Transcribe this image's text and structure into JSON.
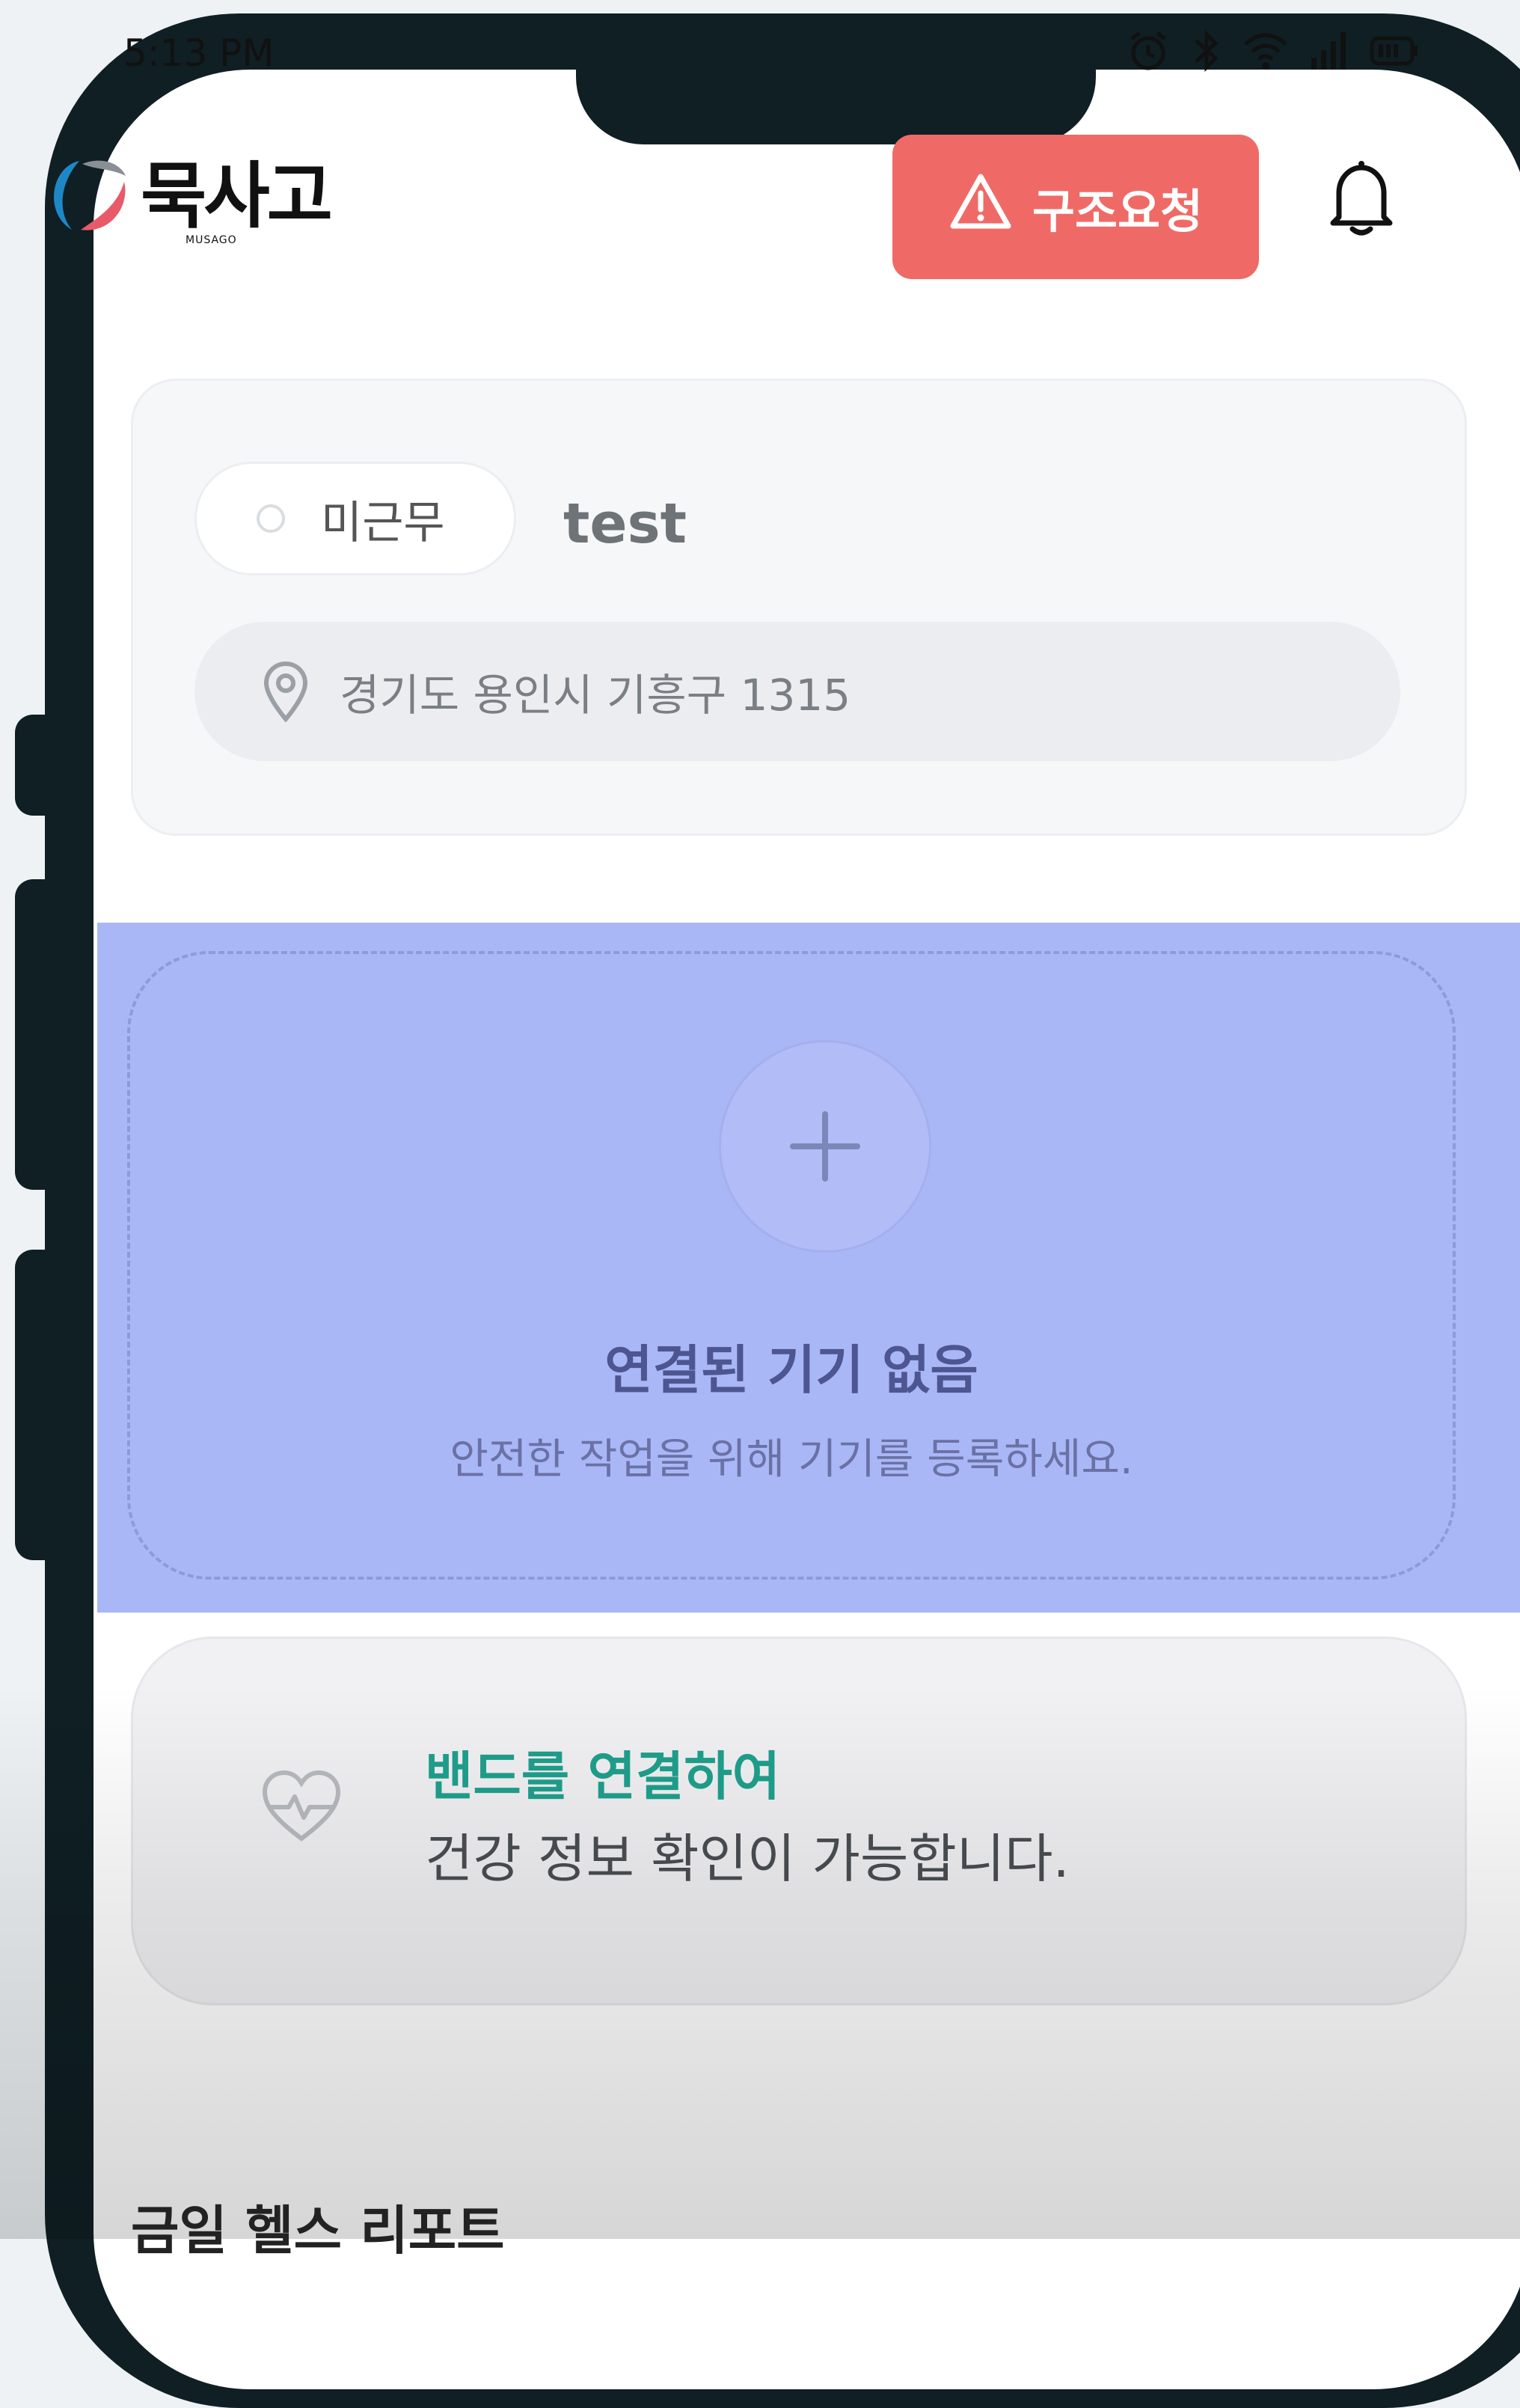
{
  "status_bar": {
    "time": "5:13 PM"
  },
  "header": {
    "logo_text": "묵사고",
    "logo_sub": "MUSAGO",
    "sos_label": "구조요청"
  },
  "worker": {
    "status": "미근무",
    "name": "test",
    "location": "경기도 용인시 기흥구 1315"
  },
  "device": {
    "title": "연결된 기기 없음",
    "subtitle": "안전한 작업을 위해 기기를 등록하세요."
  },
  "band": {
    "title": "밴드를 연결하여",
    "description": "건강 정보 확인이 가능합니다."
  },
  "report": {
    "title": "금일 헬스 리포트"
  },
  "colors": {
    "sos": "#ef6a66",
    "band_accent": "#1fa08d",
    "overlay": "#aab7f7"
  }
}
